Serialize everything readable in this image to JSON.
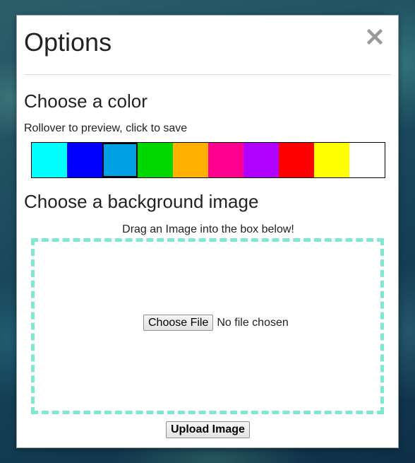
{
  "dialog": {
    "title": "Options",
    "close_icon": "close-icon"
  },
  "color_section": {
    "heading": "Choose a color",
    "hint": "Rollover to preview, click to save",
    "swatches": [
      {
        "name": "cyan",
        "color": "#00ffff",
        "selected": false
      },
      {
        "name": "blue",
        "color": "#0000ff",
        "selected": false
      },
      {
        "name": "sky-blue",
        "color": "#00a0e4",
        "selected": true
      },
      {
        "name": "green",
        "color": "#00d800",
        "selected": false
      },
      {
        "name": "orange",
        "color": "#ffb000",
        "selected": false
      },
      {
        "name": "pink",
        "color": "#ff0090",
        "selected": false
      },
      {
        "name": "purple",
        "color": "#b000ff",
        "selected": false
      },
      {
        "name": "red",
        "color": "#ff0000",
        "selected": false
      },
      {
        "name": "yellow",
        "color": "#ffff00",
        "selected": false
      },
      {
        "name": "white",
        "color": "#ffffff",
        "selected": false
      }
    ]
  },
  "background_section": {
    "heading": "Choose a background image",
    "drop_caption": "Drag an Image into the box below!",
    "drop_zone_border_color": "#7fe8cf",
    "choose_file_label": "Choose File",
    "file_status": "No file chosen",
    "upload_label": "Upload Image"
  }
}
